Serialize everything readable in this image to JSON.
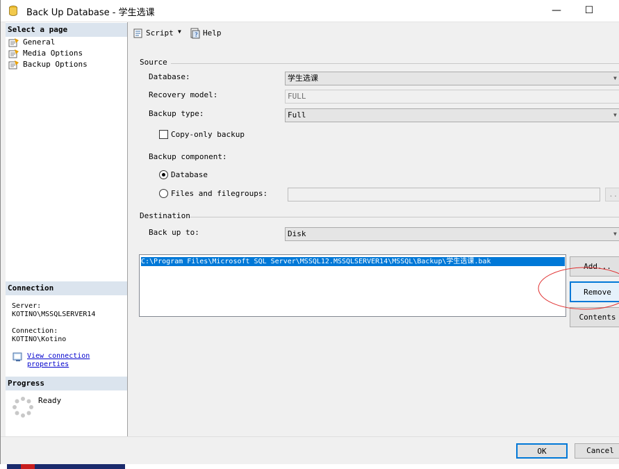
{
  "window": {
    "title": "Back Up Database - 学生选课",
    "minimize_glyph": "—",
    "maximize_glyph": "☐"
  },
  "left_panel": {
    "select_page_header": "Select a page",
    "pages": [
      {
        "label": "General",
        "icon": "page-icon"
      },
      {
        "label": "Media Options",
        "icon": "page-icon"
      },
      {
        "label": "Backup Options",
        "icon": "page-icon"
      }
    ],
    "connection_header": "Connection",
    "server_label": "Server:",
    "server_value": "KOTINO\\MSSQLSERVER14",
    "connection_label": "Connection:",
    "connection_value": "KOTINO\\Kotino",
    "view_link_line1": "View connection",
    "view_link_line2": "properties",
    "progress_header": "Progress",
    "progress_status": "Ready"
  },
  "toolbar": {
    "script_label": "Script",
    "help_label": "Help"
  },
  "source": {
    "group_label": "Source",
    "database_label": "Database:",
    "database_value": "学生选课",
    "recovery_label": "Recovery model:",
    "recovery_value": "FULL",
    "backup_type_label": "Backup type:",
    "backup_type_value": "Full",
    "copy_only_label": "Copy-only backup",
    "copy_only_checked": false,
    "component_label": "Backup component:",
    "component_database_label": "Database",
    "component_files_label": "Files and filegroups:",
    "selected_component": "Database",
    "files_value": "",
    "browse_label": "..."
  },
  "destination": {
    "group_label": "Destination",
    "back_up_to_label": "Back up to:",
    "back_up_to_value": "Disk",
    "paths": [
      "C:\\Program Files\\Microsoft SQL Server\\MSSQL12.MSSQLSERVER14\\MSSQL\\Backup\\学生选课.bak"
    ],
    "add_label": "Add...",
    "remove_label": "Remove",
    "contents_label": "Contents"
  },
  "dialog": {
    "ok_label": "OK",
    "cancel_label": "Cancel"
  },
  "colors": {
    "section_header": "#dbe4ee",
    "selection": "#0078d7",
    "annotation_circle": "#e03030",
    "focus_button": "#e5f1fb"
  }
}
